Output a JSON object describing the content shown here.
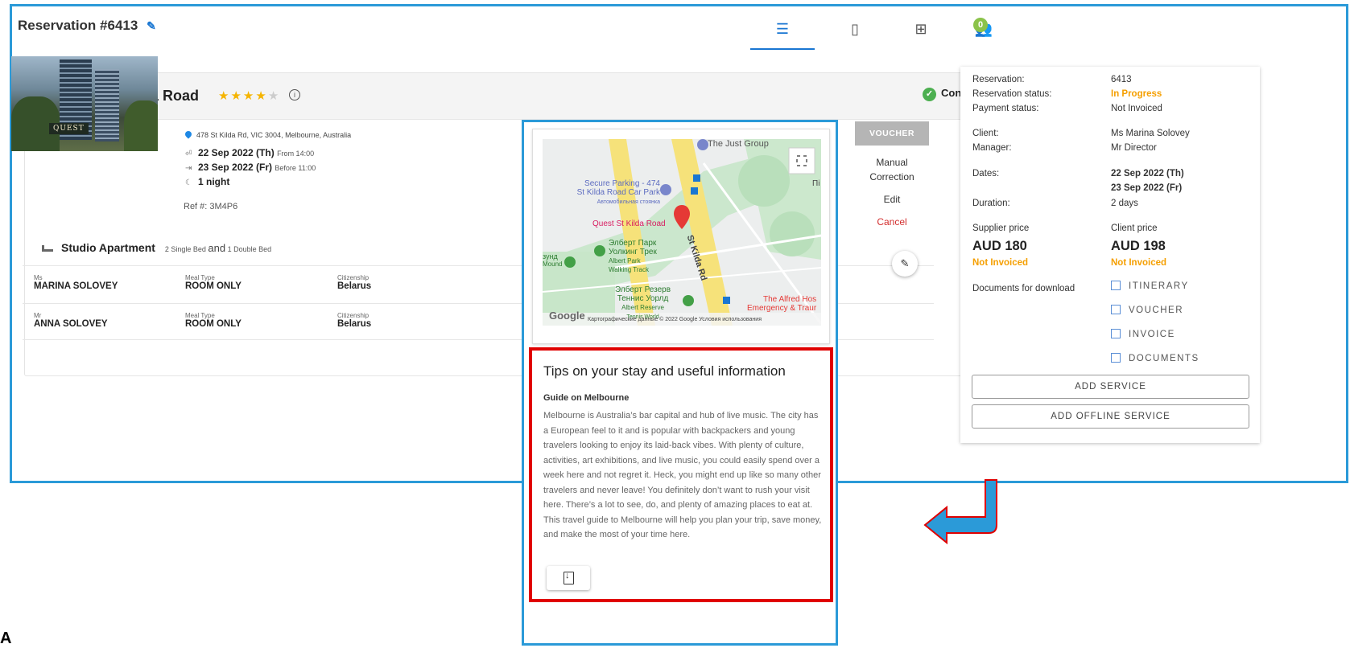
{
  "reservation": {
    "title": "Reservation #6413"
  },
  "toolbar": {
    "tabs": [
      "list-view",
      "map-view",
      "table-view",
      "guests"
    ],
    "guest_badge": "0"
  },
  "hotel": {
    "name": "Quest St Kilda Road",
    "stars": 4,
    "status": "Confirmed",
    "image_brand": "QUEST",
    "address": "478 St Kilda Rd, VIC 3004, Melbourne, Australia",
    "checkin_date": "22 Sep 2022 (Th)",
    "checkin_note": "From 14:00",
    "checkout_date": "23 Sep 2022 (Fr)",
    "checkout_note": "Before 11:00",
    "nights": "1 night",
    "ref": "Ref #: 3M4P6",
    "room_type": "Studio Apartment",
    "beds_a": "2 Single Bed",
    "beds_and": "and",
    "beds_b": "1 Double Bed",
    "guests": [
      {
        "title": "Ms",
        "name": "MARINA SOLOVEY",
        "meal_label": "Meal Type",
        "meal": "ROOM ONLY",
        "cit_label": "Citizenship",
        "citizenship": "Belarus"
      },
      {
        "title": "Mr",
        "name": "ANNA SOLOVEY",
        "meal_label": "Meal Type",
        "meal": "ROOM ONLY",
        "cit_label": "Citizenship",
        "citizenship": "Belarus"
      }
    ],
    "actions": {
      "voucher": "VOUCHER",
      "manual_1": "Manual",
      "manual_2": "Correction",
      "edit": "Edit",
      "cancel": "Cancel"
    }
  },
  "map": {
    "labels": {
      "just_group": "The Just Group",
      "parking_1": "Secure Parking - 474",
      "parking_2": "St Kilda Road Car Park",
      "parking_3": "Автомобильная стоянка",
      "hotel": "Quest St Kilda Road",
      "road": "St Kilda Rd",
      "park_1": "Элберт Парк",
      "park_2": "Уолкинг Трек",
      "park_3": "Albert Park",
      "park_4": "Walking Track",
      "reserve_1": "Элберт Резерв",
      "reserve_2": "Теннис Уорлд",
      "reserve_3": "Albert Reserve",
      "reserve_4": "Tennis World",
      "hospital_1": "The Alfred Hos",
      "hospital_2": "Emergency & Traur",
      "left_1": "зунд",
      "left_2": "Mound",
      "edge": "Пі",
      "google": "Google",
      "attribution": "Картографические данные © 2022 Google   Условия использования"
    }
  },
  "tips": {
    "title": "Tips on your stay and useful information",
    "guide_title": "Guide on Melbourne",
    "guide_text": "Melbourne is Australia’s bar capital and hub of live music. The city has a European feel to it and is popular with backpackers and young travelers looking to enjoy its laid-back vibes. With plenty of culture, activities, art exhibitions, and live music, you could easily spend over a week here and not regret it. Heck, you might end up like so many other travelers and never leave! You definitely don’t want to rush your visit here. There’s a lot to see, do, and plenty of amazing places to eat at. This travel guide to Melbourne will help you plan your trip, save money, and make the most of your time here."
  },
  "summary": {
    "reservation_label": "Reservation:",
    "reservation_value": "6413",
    "res_status_label": "Reservation status:",
    "res_status_value": "In Progress",
    "pay_status_label": "Payment status:",
    "pay_status_value": "Not Invoiced",
    "client_label": "Client:",
    "client_value": "Ms Marina Solovey",
    "manager_label": "Manager:",
    "manager_value": "Mr Director",
    "dates_label": "Dates:",
    "date_from": "22 Sep 2022 (Th)",
    "date_to": "23 Sep 2022 (Fr)",
    "duration_label": "Duration:",
    "duration_value": "2 days",
    "supplier_price_label": "Supplier price",
    "supplier_price": "AUD 180",
    "supplier_status": "Not Invoiced",
    "client_price_label": "Client price",
    "client_price": "AUD 198",
    "client_status": "Not Invoiced",
    "docs_label": "Documents for download",
    "docs": [
      "ITINERARY",
      "VOUCHER",
      "INVOICE",
      "DOCUMENTS"
    ],
    "add_service": "ADD SERVICE",
    "add_offline_service": "ADD OFFLINE SERVICE"
  },
  "colors": {
    "accent": "#1976d2",
    "frame": "#2b9ad8",
    "highlight": "#e00000",
    "warning": "#f59f00",
    "success": "#4caf50"
  },
  "stray_char": "A"
}
